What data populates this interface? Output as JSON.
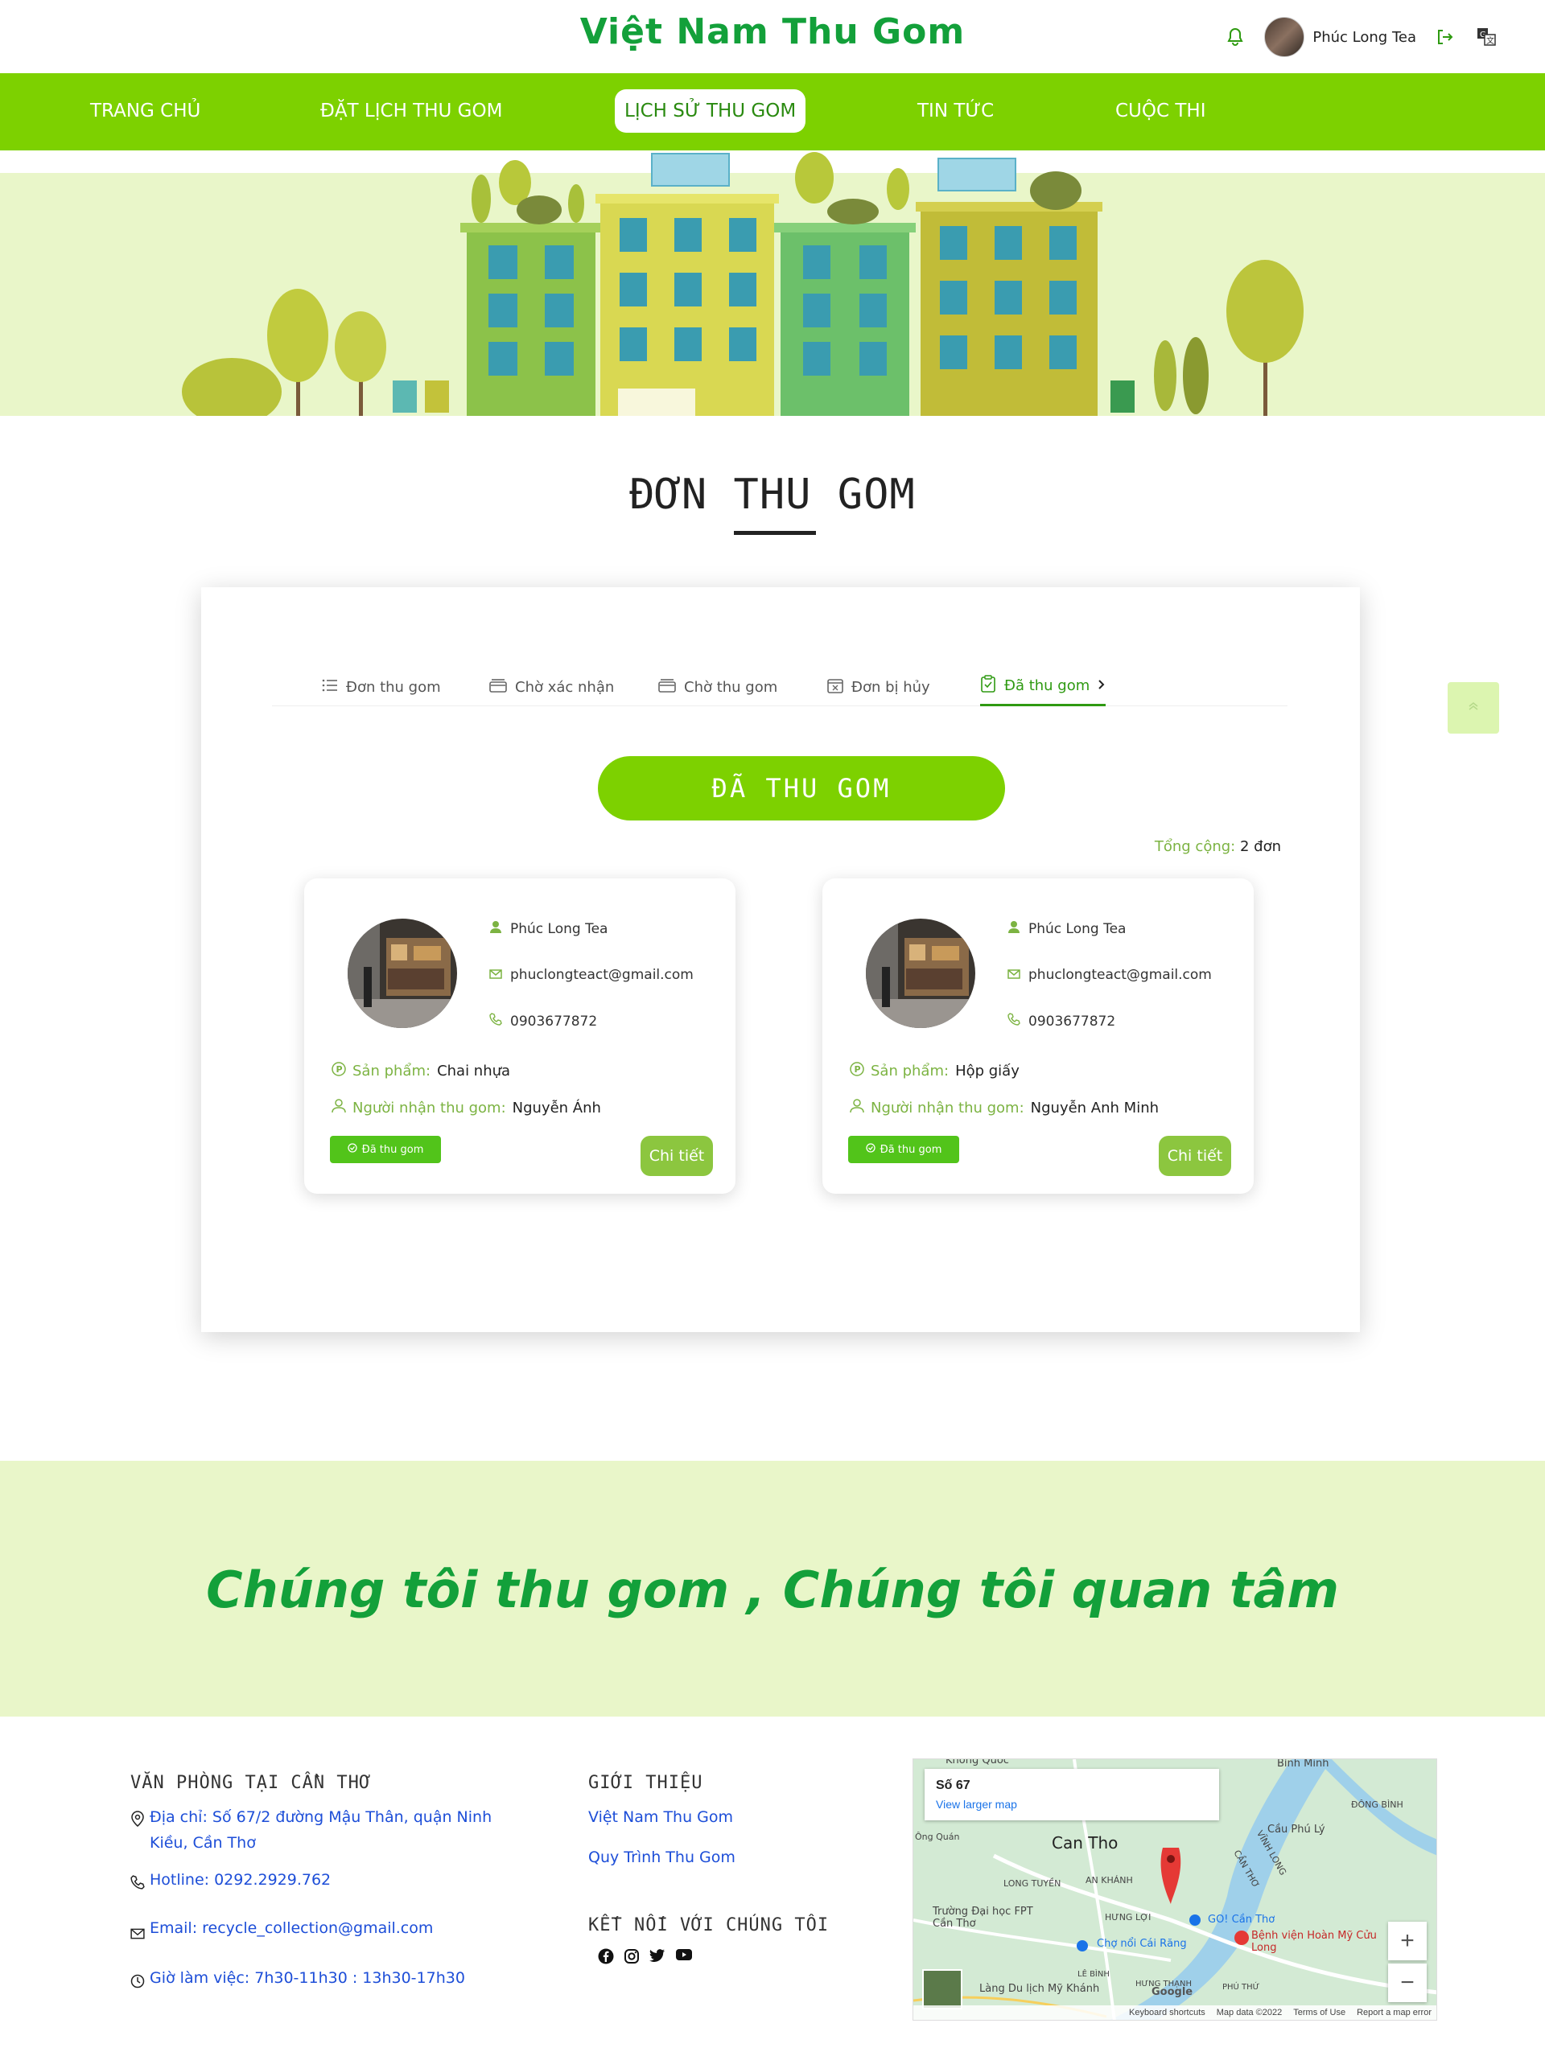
{
  "header": {
    "brand": "Việt Nam Thu Gom",
    "user_name": "Phúc Long Tea"
  },
  "nav": {
    "items": [
      {
        "label": "TRANG CHỦ"
      },
      {
        "label": "ĐẶT LỊCH THU GOM"
      },
      {
        "label": "LỊCH SỬ THU GOM"
      },
      {
        "label": "TIN TỨC"
      },
      {
        "label": "CUỘC THI"
      }
    ],
    "active_index": 2
  },
  "section": {
    "title_part1": "ĐƠN ",
    "title_part2": "THU",
    "title_part3": " GOM"
  },
  "tabs": [
    {
      "label": "Đơn thu gom",
      "icon": "list-icon"
    },
    {
      "label": "Chờ xác nhận",
      "icon": "tray-icon"
    },
    {
      "label": "Chờ thu gom",
      "icon": "tray-icon"
    },
    {
      "label": "Đơn bị hủy",
      "icon": "calendar-x-icon"
    },
    {
      "label": "Đã thu gom",
      "icon": "clipboard-check-icon"
    }
  ],
  "status_pill": "ĐÃ THU GOM",
  "total": {
    "label": "Tổng cộng:",
    "value": "2 đơn"
  },
  "orders": [
    {
      "name": "Phúc Long Tea",
      "email": "phuclongteact@gmail.com",
      "phone": "0903677872",
      "product_label": "Sản phẩm:",
      "product": "Chai nhựa",
      "receiver_label": "Người nhận thu gom:",
      "receiver": "Nguyễn Ánh",
      "badge": "Đã thu gom",
      "button": "Chi tiết"
    },
    {
      "name": "Phúc Long Tea",
      "email": "phuclongteact@gmail.com",
      "phone": "0903677872",
      "product_label": "Sản phẩm:",
      "product": "Hộp giấy",
      "receiver_label": "Người nhận thu gom:",
      "receiver": "Nguyễn Anh Minh",
      "badge": "Đã thu gom",
      "button": "Chi tiết"
    }
  ],
  "slogan": "Chúng tôi thu gom , Chúng tôi quan tâm",
  "footer": {
    "office_heading": "VĂN PHÒNG TẠI CẦN THƠ",
    "address": "Địa chỉ: Số 67/2 đường Mậu Thân, quận Ninh Kiều, Cần Thơ",
    "hotline": "Hotline: 0292.2929.762",
    "email": "Email: recycle_collection@gmail.com",
    "hours": "Giờ làm việc: 7h30-11h30 : 13h30-17h30",
    "intro_heading": "GIỚI THIỆU",
    "intro_links": [
      "Việt Nam Thu Gom",
      "Quy Trình Thu Gom"
    ],
    "connect_heading": "KẾT NỐI VỚI CHÚNG TÔI",
    "social_icons": [
      "facebook-icon",
      "instagram-icon",
      "twitter-icon",
      "youtube-icon"
    ]
  },
  "map": {
    "place": "Số 67",
    "link": "View larger map",
    "city": "Can Tho",
    "labels": [
      "Khong Quoc",
      "Bình Minh",
      "ĐÔNG BÌNH",
      "Cầu Phú Lý",
      "LONG TUYỀN",
      "AN KHÁNH",
      "Trường Đại học FPT Cần Thơ",
      "HƯNG LỢI",
      "Chợ nổi Cái Răng",
      "GO! Cần Thơ",
      "Bệnh viện Hoàn Mỹ Cửu Long",
      "Làng Du lịch Mỹ Khánh",
      "VĨNH LONG",
      "CẦN THƠ",
      "LÊ BÌNH",
      "HƯNG THẠNH",
      "PHÚ THỨ",
      "Ông Quán"
    ],
    "footer": [
      "Keyboard shortcuts",
      "Map data ©2022",
      "Terms of Use",
      "Report a map error"
    ],
    "brand": "Google",
    "colors": {
      "land": "#cde8cf",
      "water": "#9fd0ea",
      "road": "#ffffff",
      "pin": "#e53935"
    }
  },
  "colors": {
    "brand_green": "#13a03a",
    "nav_green": "#7dd100",
    "accent_green": "#52c41a",
    "band": "#e9f6c9"
  }
}
